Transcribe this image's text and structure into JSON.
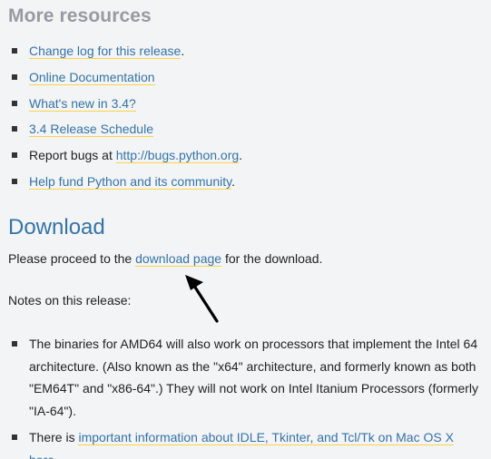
{
  "more_resources": {
    "title": "More resources",
    "items": [
      {
        "link": "Change log for this release",
        "after": "."
      },
      {
        "link": "Online Documentation",
        "after": ""
      },
      {
        "link": "What's new in 3.4?",
        "after": ""
      },
      {
        "link": "3.4 Release Schedule",
        "after": ""
      },
      {
        "before": "Report bugs at ",
        "link": "http://bugs.python.org",
        "after": "."
      },
      {
        "link": "Help fund Python and its community",
        "after": "."
      }
    ]
  },
  "download": {
    "title": "Download",
    "line_before": "Please proceed to the ",
    "link": "download page",
    "line_after": " for the download.",
    "notes_heading": "Notes on this release:",
    "notes": [
      {
        "text": "The binaries for AMD64 will also work on processors that implement the Intel 64 architecture. (Also known as the \"x64\" architecture, and formerly known as both \"EM64T\" and \"x86-64\".) They will not work on Intel Itanium Processors (formerly \"IA-64\")."
      },
      {
        "before": "There is ",
        "link": "important information about IDLE, Tkinter, and Tcl/Tk on Mac OS X here",
        "after": "."
      }
    ]
  },
  "colors": {
    "link": "#3673a5",
    "link_underline": "#ffd343",
    "heading_gray": "#999aa0",
    "background": "#f2f4f6"
  },
  "icons": {
    "annotation_arrow": "arrow-pointing-up-left"
  }
}
